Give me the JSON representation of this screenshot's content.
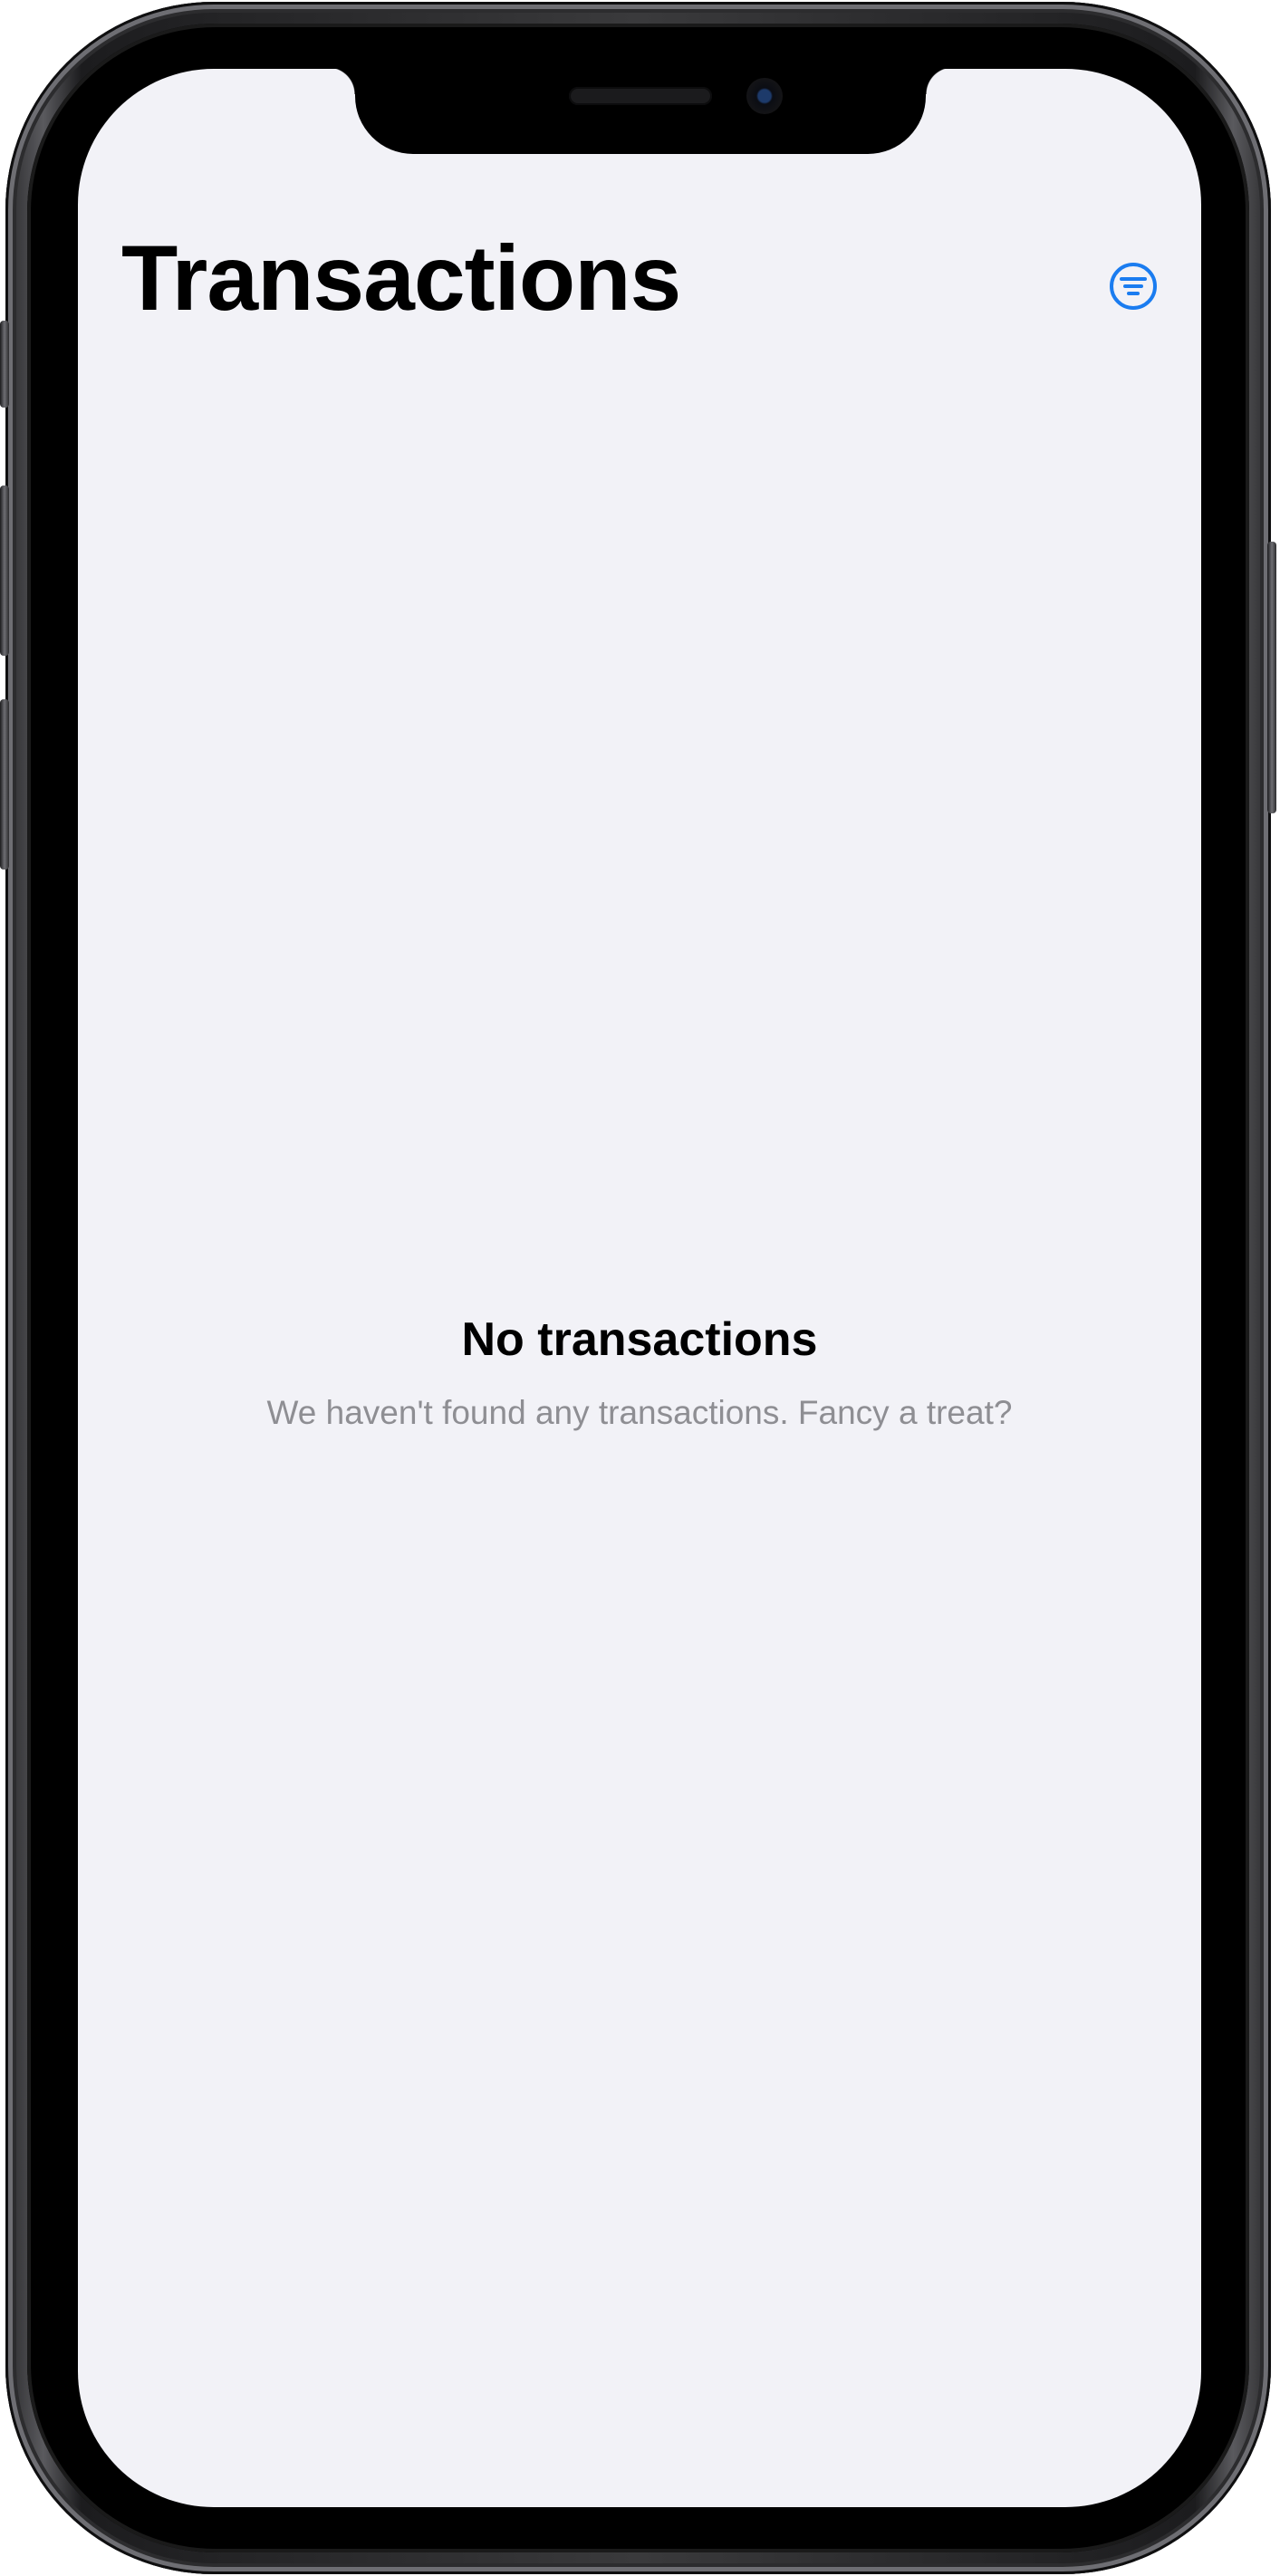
{
  "header": {
    "title": "Transactions",
    "filter_icon": "filter-circle-icon",
    "accent_color": "#1a7cf0"
  },
  "empty_state": {
    "title": "No transactions",
    "subtitle": "We haven't found any transactions. Fancy a treat?"
  },
  "colors": {
    "background": "#f2f2f7",
    "title_text": "#000000",
    "secondary_text": "#8e8e93"
  }
}
